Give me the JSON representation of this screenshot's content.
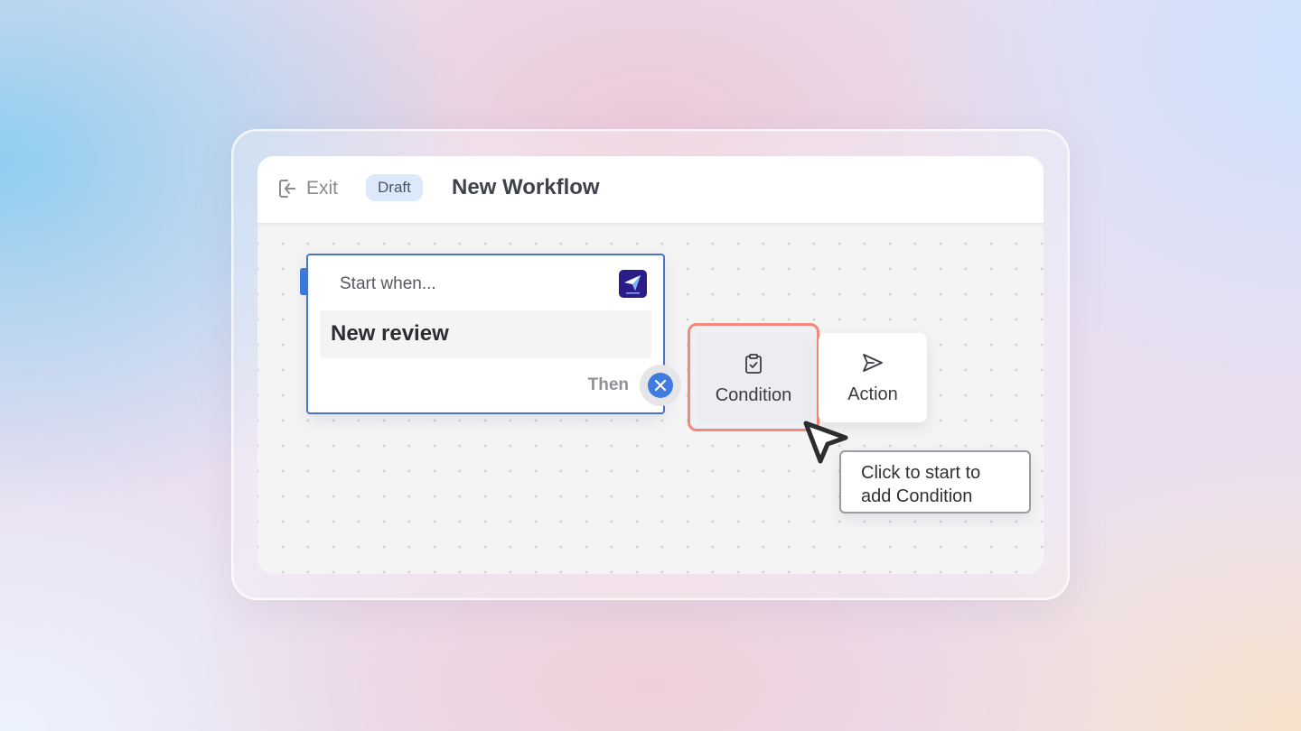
{
  "header": {
    "exit_label": "Exit",
    "status_badge": "Draft",
    "title": "New Workflow"
  },
  "trigger": {
    "start_label": "Start when...",
    "event": "New review",
    "then_label": "Then",
    "app_logo_icon": "avada-icon"
  },
  "options": [
    {
      "label": "Condition",
      "icon": "clipboard-check-icon",
      "highlighted": true
    },
    {
      "label": "Action",
      "icon": "send-icon"
    }
  ],
  "tooltip": {
    "line1": "Click to start to",
    "line2": "add Condition"
  },
  "colors": {
    "accent": "#4a74c9",
    "port_blue": "#3f7be0",
    "highlight": "#f4887a",
    "badge_bg": "#dbe9fb"
  }
}
